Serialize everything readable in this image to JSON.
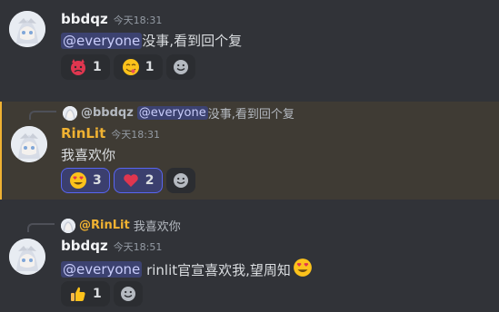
{
  "messages": [
    {
      "username": "bbdqz",
      "timestamp": "今天18:31",
      "mention": "@everyone",
      "text": "没事,看到回个复",
      "reactions": [
        {
          "emoji": "angry-devil-emoji",
          "count": "1"
        },
        {
          "emoji": "yum-face-emoji",
          "count": "1"
        }
      ]
    },
    {
      "reply": {
        "username": "@bbdqz",
        "mention": "@everyone",
        "text": "没事,看到回个复"
      },
      "username": "RinLit",
      "timestamp": "今天18:31",
      "text": "我喜欢你",
      "reactions": [
        {
          "emoji": "heart-eyes-emoji",
          "count": "3"
        },
        {
          "emoji": "red-heart-emoji",
          "count": "2"
        }
      ]
    },
    {
      "reply": {
        "username": "@RinLit",
        "text": "我喜欢你"
      },
      "username": "bbdqz",
      "timestamp": "今天18:51",
      "mention": "@everyone",
      "text": " rinlit官宣喜欢我,望周知",
      "reactions": [
        {
          "emoji": "thumbs-up-emoji",
          "count": "1"
        }
      ]
    }
  ],
  "colors": {
    "background": "#313338",
    "highlight": "#3f3b34",
    "mention": "#3c4270",
    "gold_name": "#f0b232"
  }
}
